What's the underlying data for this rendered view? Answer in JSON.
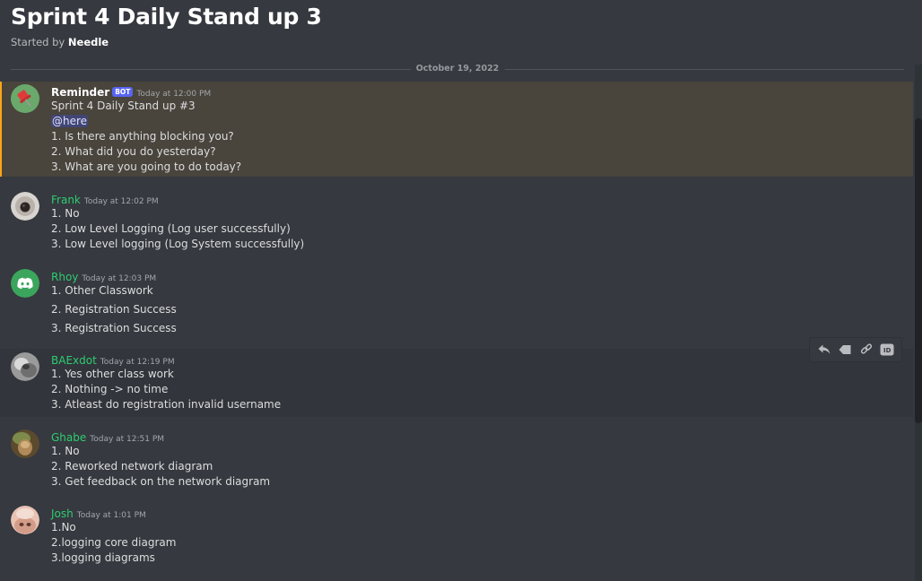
{
  "thread": {
    "title": "Sprint 4 Daily Stand up 3",
    "started_by_label": "Started by",
    "started_by": "Needle",
    "date_divider": "October 19, 2022"
  },
  "colors": {
    "background": "#36393f",
    "mention_highlight": "#49443c",
    "mention_border": "#faa61a",
    "username_green": "#2ecc71",
    "bot_tag": "#5865f2"
  },
  "messages": [
    {
      "author": "Reminder",
      "bot_tag": "BOT",
      "timestamp": "Today at 12:00 PM",
      "avatar_icon": "red-pushpin-icon",
      "lines": [
        "Sprint 4 Daily Stand up #3",
        "@here",
        "1. Is there anything blocking you?",
        "2. What did you do yesterday?",
        "3. What are you going to do today?"
      ]
    },
    {
      "author": "Frank",
      "timestamp": "Today at 12:02 PM",
      "avatar_icon": "camera-lens-avatar",
      "lines": [
        "1. No",
        "2. Low Level Logging (Log user successfully)",
        "3. Low Level logging (Log System successfully)"
      ]
    },
    {
      "author": "Rhoy",
      "timestamp": "Today at 12:03 PM",
      "avatar_icon": "discord-default-avatar",
      "lines": [
        "1. Other Classwork",
        "2. Registration Success",
        "3. Registration Success"
      ]
    },
    {
      "author": "BAExdot",
      "timestamp": "Today at 12:19 PM",
      "avatar_icon": "grayscale-photo-avatar",
      "lines": [
        "1. Yes other class work",
        "2. Nothing -> no time",
        "3. Atleast do registration invalid username"
      ]
    },
    {
      "author": "Ghabe",
      "timestamp": "Today at 12:51 PM",
      "avatar_icon": "photo-avatar",
      "lines": [
        "1. No",
        "2. Reworked network diagram",
        "3. Get feedback on the network diagram"
      ]
    },
    {
      "author": "Josh",
      "timestamp": "Today at 1:01 PM",
      "avatar_icon": "photo-avatar",
      "lines": [
        "1.No",
        "2.logging core diagram",
        "3.logging diagrams"
      ]
    }
  ],
  "toolbar": {
    "reply_icon": "reply-icon",
    "tag_icon": "tag-icon",
    "link_icon": "link-icon",
    "id_icon": "copy-id-icon",
    "id_label": "ID"
  }
}
